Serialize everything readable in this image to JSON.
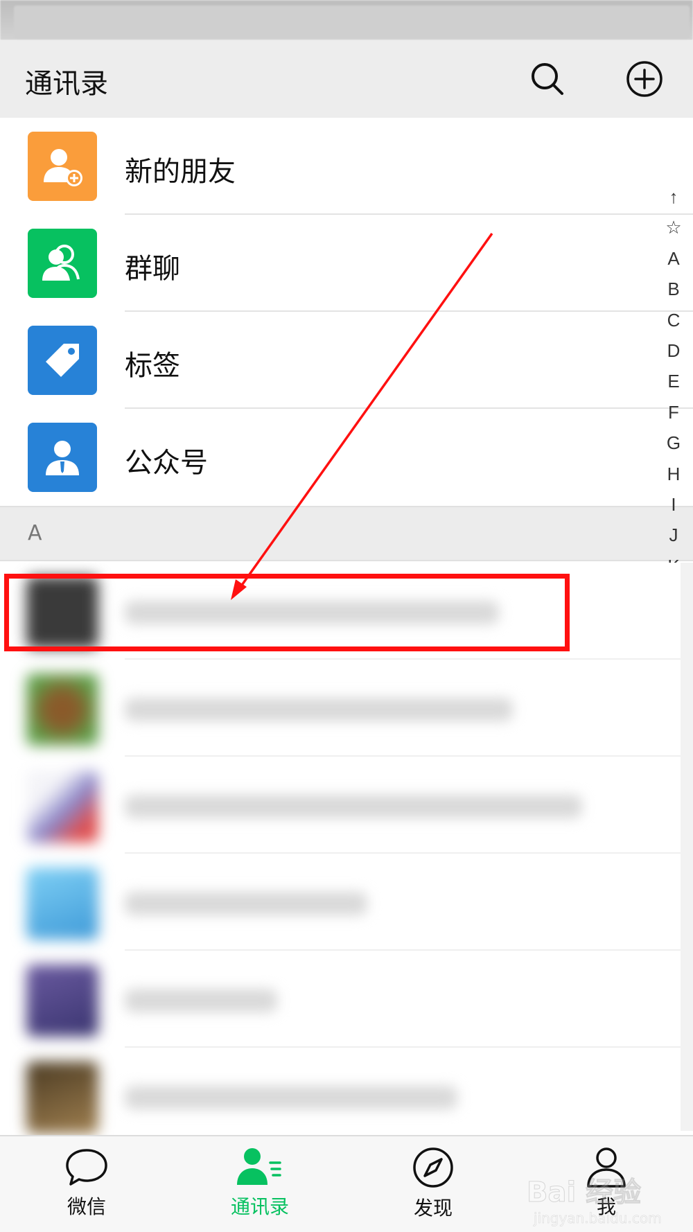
{
  "header": {
    "title": "通讯录"
  },
  "functions": [
    {
      "label": "新的朋友",
      "icon": "add-friend-icon",
      "color": "#fa9d3b"
    },
    {
      "label": "群聊",
      "icon": "group-chat-icon",
      "color": "#07c160"
    },
    {
      "label": "标签",
      "icon": "tag-icon",
      "color": "#2782d7"
    },
    {
      "label": "公众号",
      "icon": "official-account-icon",
      "color": "#2782d7"
    }
  ],
  "section": {
    "letter": "A"
  },
  "alpha_index": [
    "↑",
    "☆",
    "A",
    "B",
    "C",
    "D",
    "E",
    "F",
    "G",
    "H",
    "I",
    "J",
    "K"
  ],
  "tabs": [
    {
      "label": "微信",
      "icon": "chat-bubble-icon",
      "active": false
    },
    {
      "label": "通讯录",
      "icon": "contacts-icon",
      "active": true
    },
    {
      "label": "发现",
      "icon": "compass-icon",
      "active": false
    },
    {
      "label": "我",
      "icon": "person-icon",
      "active": false
    }
  ],
  "colors": {
    "accent": "#07c160",
    "annotation": "#ff1010"
  },
  "watermark": {
    "main": "Bai 经验",
    "sub": "jingyan.baidu.com"
  }
}
